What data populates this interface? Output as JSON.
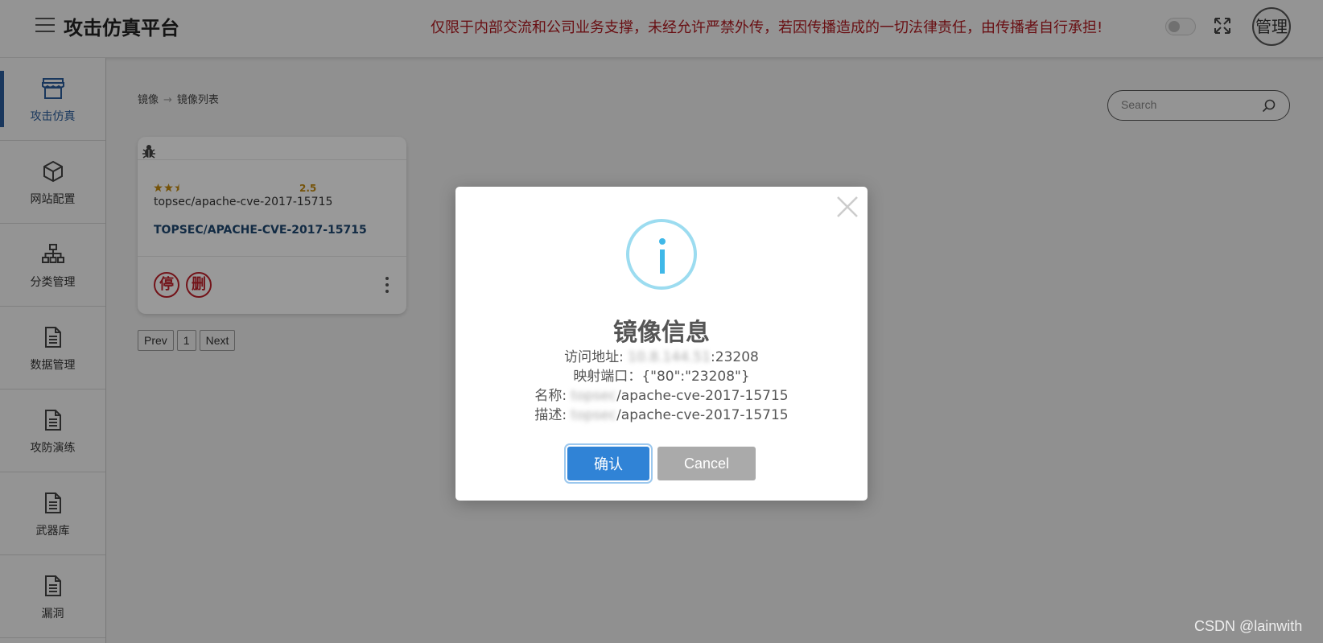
{
  "header": {
    "title": "攻击仿真平台",
    "warning": "仅限于内部交流和公司业务支撑，未经允许严禁外传，若因传播造成的一切法律责任，由传播者自行承担!",
    "avatar_label": "管理"
  },
  "sidebar": {
    "items": [
      {
        "label": "攻击仿真",
        "icon": "store-icon"
      },
      {
        "label": "网站配置",
        "icon": "cube-icon"
      },
      {
        "label": "分类管理",
        "icon": "sitemap-icon"
      },
      {
        "label": "数据管理",
        "icon": "document-icon"
      },
      {
        "label": "攻防演练",
        "icon": "document-icon"
      },
      {
        "label": "武器库",
        "icon": "document-icon"
      },
      {
        "label": "漏洞",
        "icon": "document-icon"
      }
    ]
  },
  "breadcrumb": {
    "root": "镜像",
    "current": "镜像列表"
  },
  "search": {
    "placeholder": "Search"
  },
  "card": {
    "rating": "2.5",
    "rating_value": 2.5,
    "subtitle": "topsec/apache-cve-2017-15715",
    "title": "TOPSEC/APACHE-CVE-2017-15715",
    "stop_label": "停",
    "delete_label": "删"
  },
  "pagination": {
    "prev": "Prev",
    "page": "1",
    "next": "Next"
  },
  "modal": {
    "title": "镜像信息",
    "address_label": "访问地址: ",
    "address_blurred": "10.8.144.51",
    "address_port": ":23208",
    "port_map_label": "映射端口：",
    "port_map_value": "{\"80\":\"23208\"}",
    "name_label": "名称: ",
    "name_blurred": "topsec",
    "name_value": "/apache-cve-2017-15715",
    "desc_label": "描述: ",
    "desc_blurred": "topsec",
    "desc_value": "/apache-cve-2017-15715",
    "confirm_label": "确认",
    "cancel_label": "Cancel"
  },
  "watermark": "CSDN @lainwith",
  "colors": {
    "accent": "#3083d6",
    "warning": "#b01a20",
    "danger": "#c0202a",
    "link": "#1e4872",
    "info": "#3fb8e8"
  }
}
